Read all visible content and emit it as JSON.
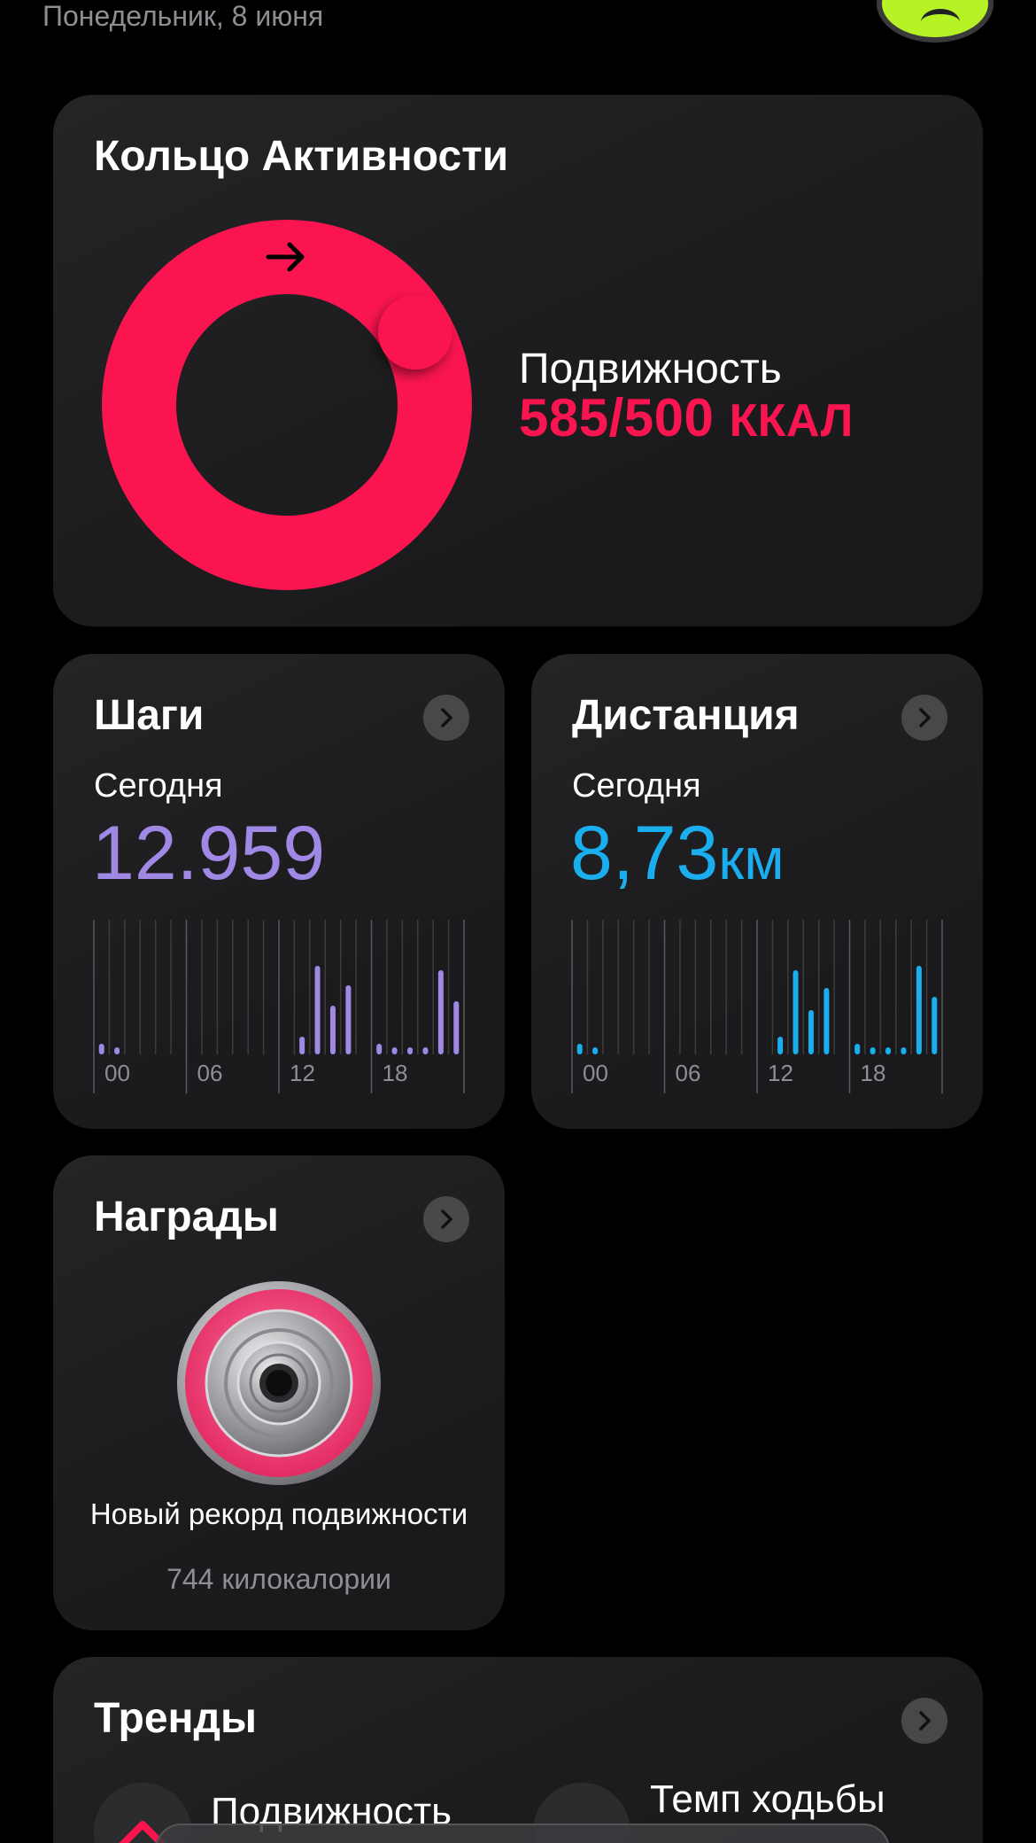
{
  "header": {
    "date": "Понедельник, 8 июня"
  },
  "activity": {
    "title": "Кольцо Активности",
    "move_label": "Подвижность",
    "move_value": "585/500",
    "move_unit": "ККАЛ",
    "progress": 1.17,
    "ring_color": "#fa1550"
  },
  "steps": {
    "title": "Шаги",
    "subtitle": "Сегодня",
    "value": "12.959",
    "color": "#9f89e5",
    "hour_ticks": [
      "00",
      "06",
      "12",
      "18"
    ],
    "bars": [
      0.12,
      0.05,
      0,
      0,
      0,
      0,
      0,
      0,
      0,
      0,
      0,
      0,
      0,
      0.2,
      1.0,
      0.55,
      0.78,
      0,
      0.12,
      0.06,
      0.07,
      0.08,
      0.95,
      0.6
    ]
  },
  "distance": {
    "title": "Дистанция",
    "subtitle": "Сегодня",
    "value": "8,73",
    "unit": "км",
    "color": "#1aaeee",
    "hour_ticks": [
      "00",
      "06",
      "12",
      "18"
    ],
    "bars": [
      0.12,
      0.05,
      0,
      0,
      0,
      0,
      0,
      0,
      0,
      0,
      0,
      0,
      0,
      0.2,
      0.95,
      0.5,
      0.75,
      0,
      0.12,
      0.06,
      0.06,
      0.08,
      1.0,
      0.65
    ]
  },
  "awards": {
    "title": "Награды",
    "award_name": "Новый рекорд подвижности",
    "award_detail": "744 килокалории"
  },
  "trends": {
    "title": "Тренды",
    "item1": "Подвижность",
    "item2": "Темп ходьбы"
  }
}
